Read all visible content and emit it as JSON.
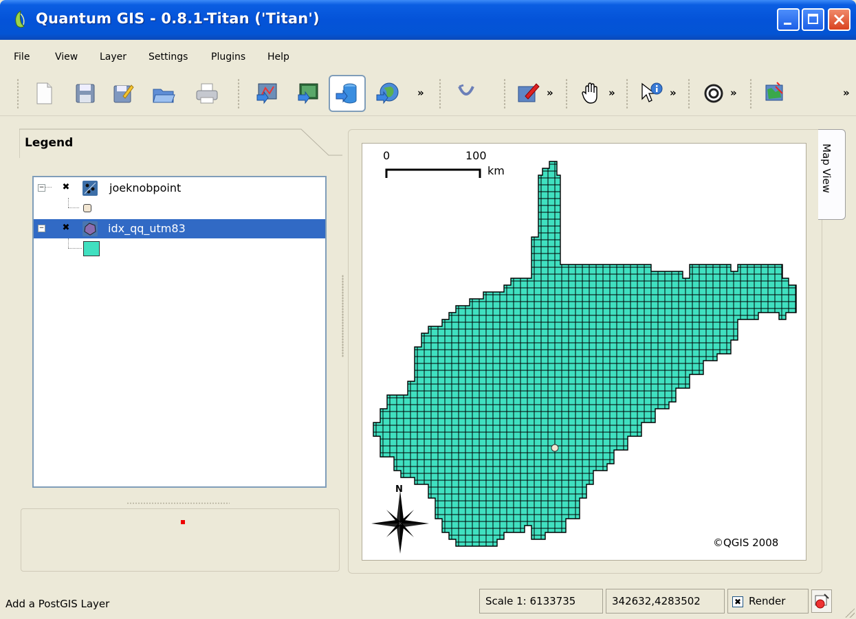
{
  "window": {
    "title": "Quantum GIS - 0.8.1-Titan ('Titan')"
  },
  "menu": {
    "items": [
      "File",
      "View",
      "Layer",
      "Settings",
      "Plugins",
      "Help"
    ]
  },
  "toolbar": {
    "buttons": [
      "new-project-icon",
      "save-project-icon",
      "save-as-icon",
      "open-project-icon",
      "print-icon",
      "add-vector-layer-icon",
      "add-raster-layer-icon",
      "add-postgis-layer-icon",
      "add-wms-layer-icon",
      "capture-icon",
      "edit-icon",
      "pan-icon",
      "identify-icon",
      "copyright-icon",
      "plugin-icon"
    ],
    "overflow_label": "»"
  },
  "legend": {
    "title": "Legend",
    "layers": [
      {
        "name": "joeknobpoint",
        "checked": "✖",
        "selected": false,
        "symbol_color": "#f2e6d2"
      },
      {
        "name": "idx_qq_utm83",
        "checked": "✖",
        "selected": true,
        "symbol_color": "#40e0c0"
      }
    ]
  },
  "map": {
    "tab_label": "Map View",
    "scale_bar": {
      "start": "0",
      "end": "100",
      "unit": "km"
    },
    "north_label": "N",
    "copyright": "©QGIS 2008",
    "fill_color": "#40e0c0",
    "outline_color": "#000000"
  },
  "status": {
    "message": "Add a PostGIS Layer",
    "scale": "Scale 1: 6133735",
    "coordinates": "342632,4283502",
    "render_label": "Render",
    "render_checked": "✖"
  }
}
